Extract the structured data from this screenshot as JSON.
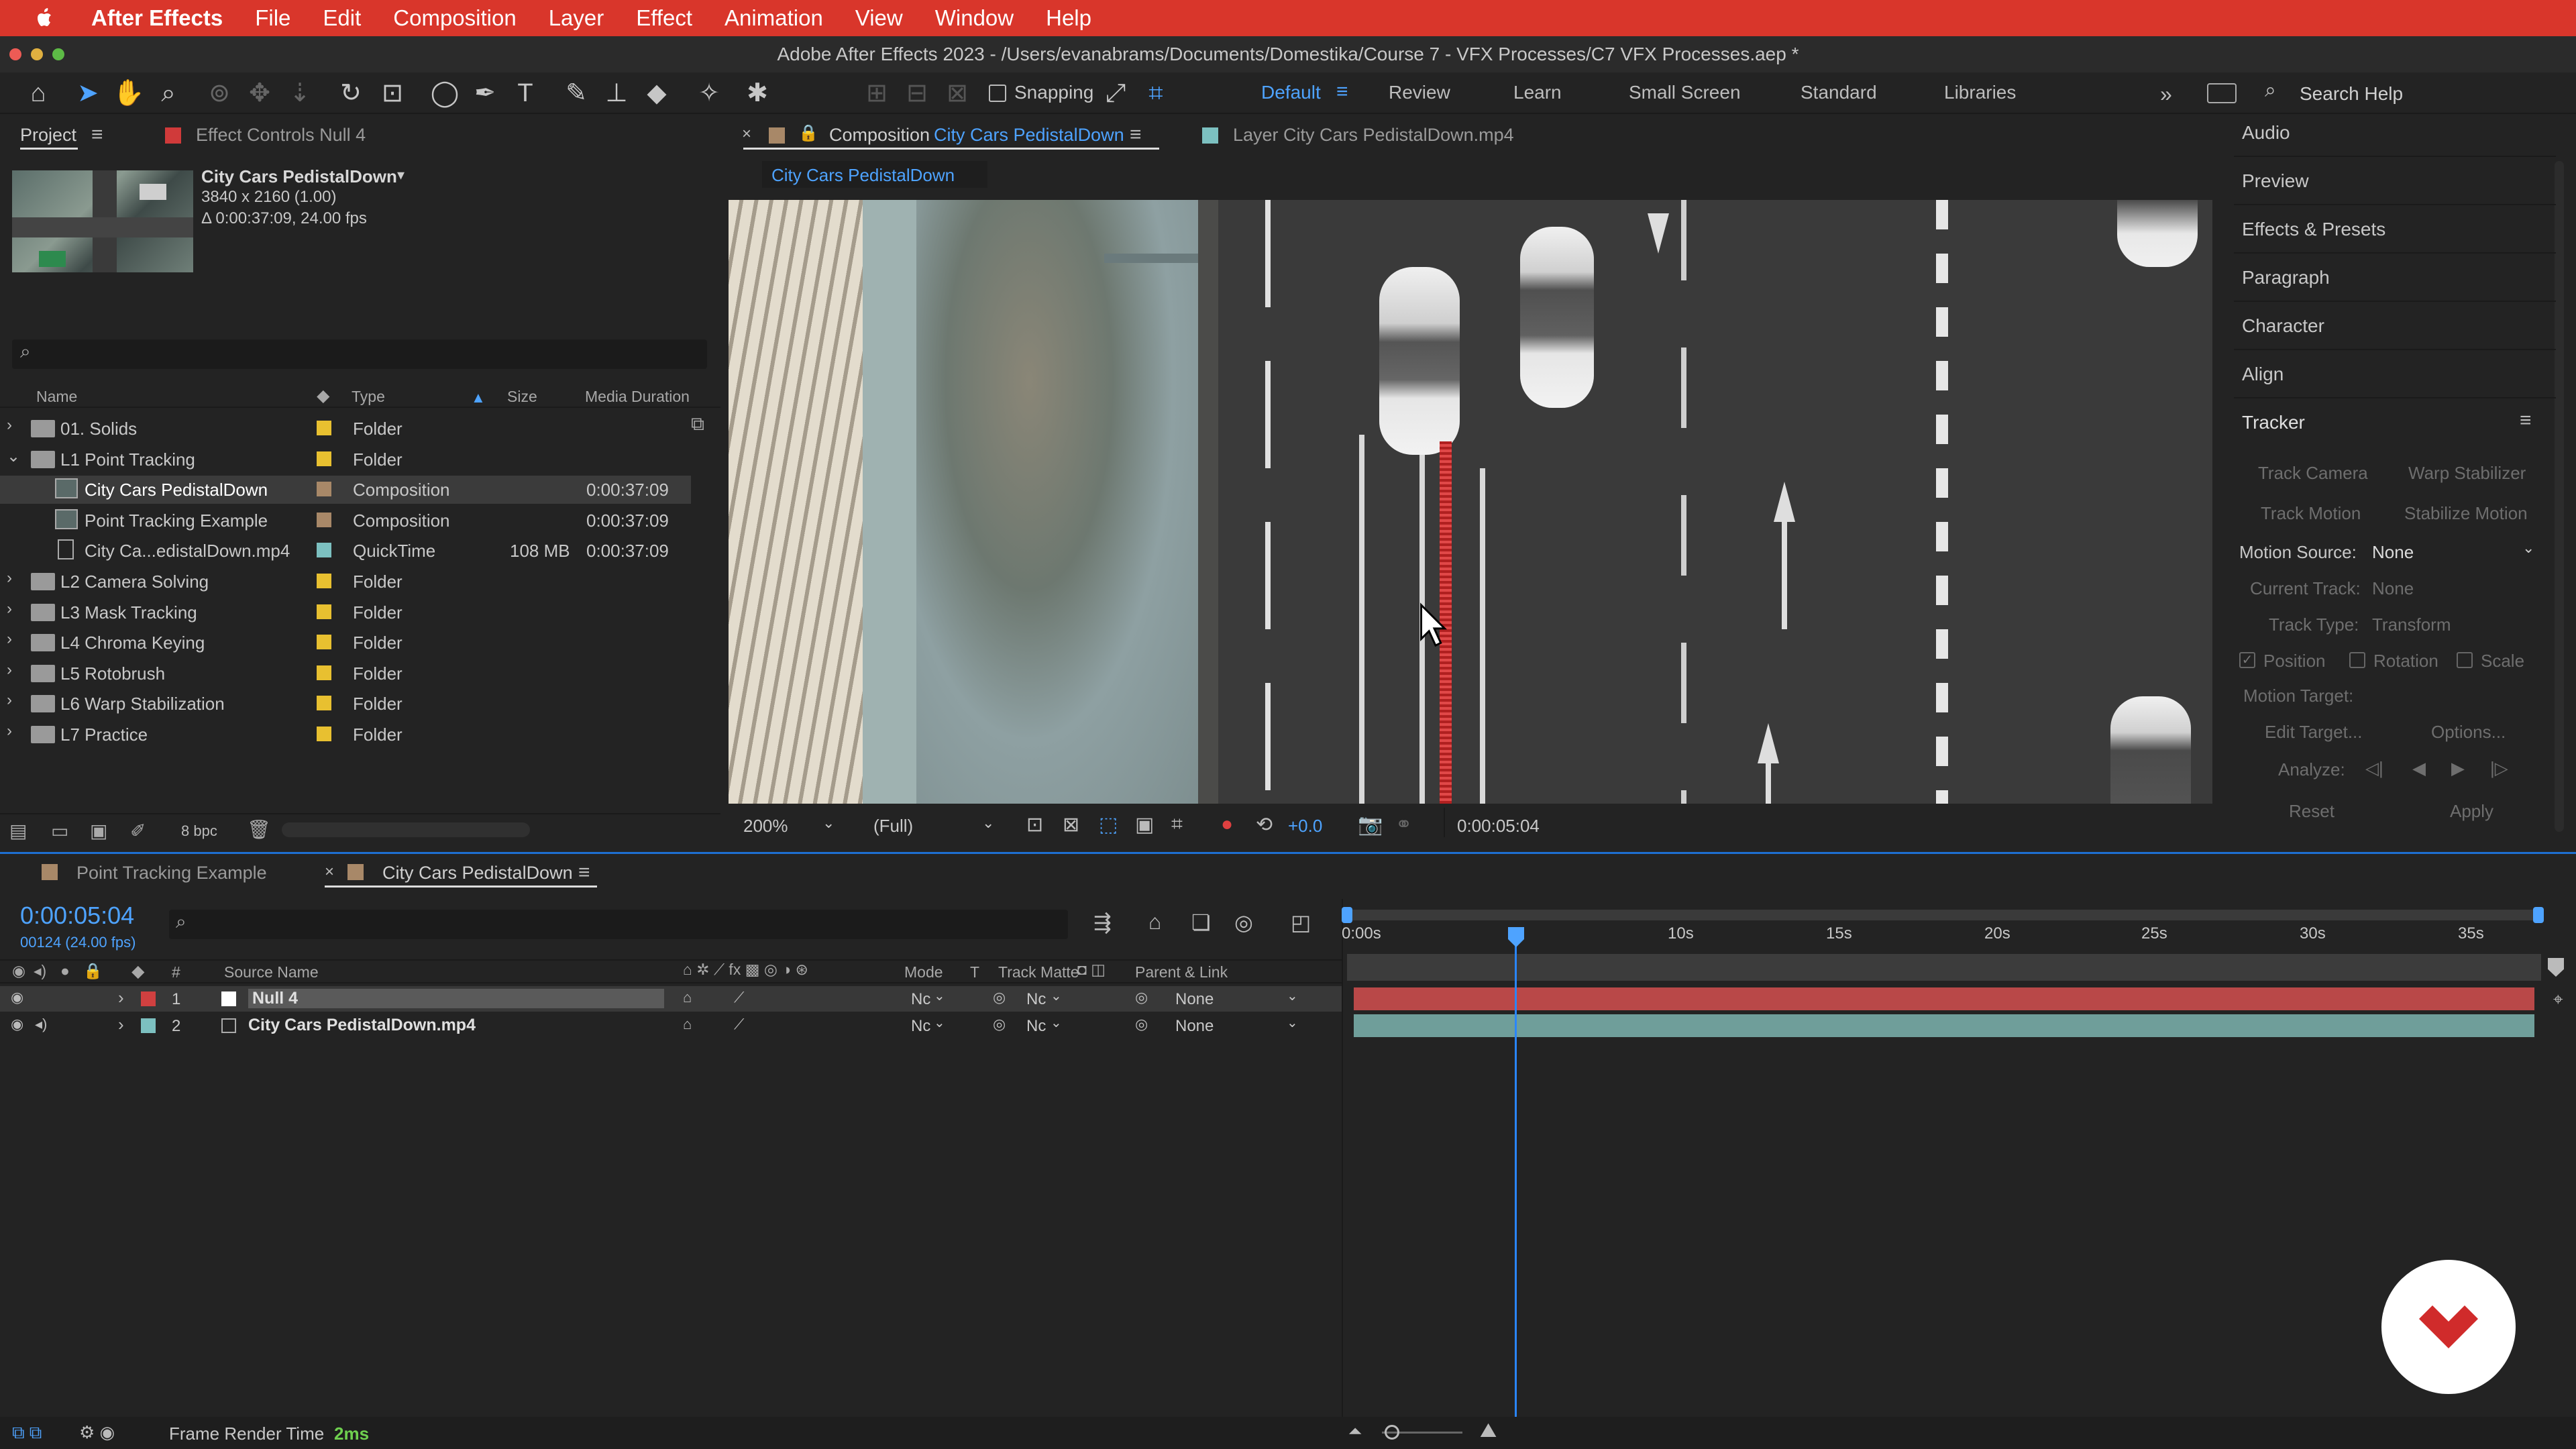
{
  "menubar": {
    "items": [
      "After Effects",
      "File",
      "Edit",
      "Composition",
      "Layer",
      "Effect",
      "Animation",
      "View",
      "Window",
      "Help"
    ]
  },
  "titlebar": {
    "title": "Adobe After Effects 2023 - /Users/evanabrams/Documents/Domestika/Course 7 - VFX Processes/C7 VFX Processes.aep *"
  },
  "toolbar": {
    "snapping_label": "Snapping",
    "workspaces": [
      "Default",
      "Review",
      "Learn",
      "Small Screen",
      "Standard",
      "Libraries"
    ],
    "active_workspace": "Default",
    "search_placeholder": "Search Help"
  },
  "project_panel": {
    "tab_project": "Project",
    "tab_effect_controls": "Effect Controls Null 4",
    "selected_name": "City Cars PedistalDown",
    "selected_info_1": "3840 x 2160 (1.00)",
    "selected_info_2": "Δ 0:00:37:09, 24.00 fps",
    "columns": {
      "name": "Name",
      "type": "Type",
      "size": "Size",
      "duration": "Media Duration"
    },
    "items": [
      {
        "name": "01. Solids",
        "type": "Folder",
        "size": "",
        "duration": "",
        "color": "#e8c030",
        "indent": 0,
        "kind": "folder",
        "open": false
      },
      {
        "name": "L1 Point Tracking",
        "type": "Folder",
        "size": "",
        "duration": "",
        "color": "#e8c030",
        "indent": 0,
        "kind": "folder",
        "open": true
      },
      {
        "name": "City Cars PedistalDown",
        "type": "Composition",
        "size": "",
        "duration": "0:00:37:09",
        "color": "#a88868",
        "indent": 1,
        "kind": "comp",
        "selected": true
      },
      {
        "name": "Point Tracking Example",
        "type": "Composition",
        "size": "",
        "duration": "0:00:37:09",
        "color": "#a88868",
        "indent": 1,
        "kind": "comp"
      },
      {
        "name": "City Ca...edistalDown.mp4",
        "type": "QuickTime",
        "size": "108 MB",
        "duration": "0:00:37:09",
        "color": "#7cc0c0",
        "indent": 1,
        "kind": "file"
      },
      {
        "name": "L2 Camera Solving",
        "type": "Folder",
        "size": "",
        "duration": "",
        "color": "#e8c030",
        "indent": 0,
        "kind": "folder"
      },
      {
        "name": "L3 Mask Tracking",
        "type": "Folder",
        "size": "",
        "duration": "",
        "color": "#e8c030",
        "indent": 0,
        "kind": "folder"
      },
      {
        "name": "L4 Chroma Keying",
        "type": "Folder",
        "size": "",
        "duration": "",
        "color": "#e8c030",
        "indent": 0,
        "kind": "folder"
      },
      {
        "name": "L5 Rotobrush",
        "type": "Folder",
        "size": "",
        "duration": "",
        "color": "#e8c030",
        "indent": 0,
        "kind": "folder"
      },
      {
        "name": "L6 Warp Stabilization",
        "type": "Folder",
        "size": "",
        "duration": "",
        "color": "#e8c030",
        "indent": 0,
        "kind": "folder"
      },
      {
        "name": "L7 Practice",
        "type": "Folder",
        "size": "",
        "duration": "",
        "color": "#e8c030",
        "indent": 0,
        "kind": "folder"
      }
    ],
    "bpc_label": "8 bpc"
  },
  "comp_panel": {
    "tab_prefix": "Composition",
    "tab_comp_name": "City Cars PedistalDown",
    "tab_layer": "Layer City Cars PedistalDown.mp4",
    "breadcrumb": "City Cars PedistalDown",
    "zoom": "200%",
    "resolution": "(Full)",
    "exposure": "+0.0",
    "timecode": "0:00:05:04"
  },
  "right_panel": {
    "sections": [
      "Audio",
      "Preview",
      "Effects & Presets",
      "Paragraph",
      "Character",
      "Align"
    ],
    "tracker": {
      "title": "Tracker",
      "track_camera": "Track Camera",
      "warp_stabilizer": "Warp Stabilizer",
      "track_motion": "Track Motion",
      "stabilize_motion": "Stabilize Motion",
      "motion_source_label": "Motion Source:",
      "motion_source_value": "None",
      "current_track_label": "Current Track:",
      "current_track_value": "None",
      "track_type_label": "Track Type:",
      "track_type_value": "Transform",
      "position": "Position",
      "rotation": "Rotation",
      "scale": "Scale",
      "motion_target": "Motion Target:",
      "edit_target": "Edit Target...",
      "options": "Options...",
      "analyze": "Analyze:",
      "reset": "Reset",
      "apply": "Apply"
    }
  },
  "timeline": {
    "tab_1": "Point Tracking Example",
    "tab_2": "City Cars PedistalDown",
    "timecode": "0:00:05:04",
    "frame_info": "00124 (24.00 fps)",
    "columns": {
      "source_name": "Source Name",
      "mode": "Mode",
      "t": "T",
      "track_matte": "Track Matte",
      "parent": "Parent & Link",
      "num": "#"
    },
    "ruler": [
      "0:00s",
      "10s",
      "15s",
      "20s",
      "25s",
      "30s",
      "35s"
    ],
    "layers": [
      {
        "num": "1",
        "name": "Null 4",
        "mode": "Nc",
        "matte": "Nc",
        "parent": "None",
        "color": "#d04040",
        "bar": "#b94848"
      },
      {
        "num": "2",
        "name": "City Cars PedistalDown.mp4",
        "mode": "Nc",
        "matte": "Nc",
        "parent": "None",
        "color": "#7cc0c0",
        "bar": "#6f9e9a"
      }
    ]
  },
  "statusbar": {
    "label": "Frame Render Time",
    "value": "2ms"
  }
}
